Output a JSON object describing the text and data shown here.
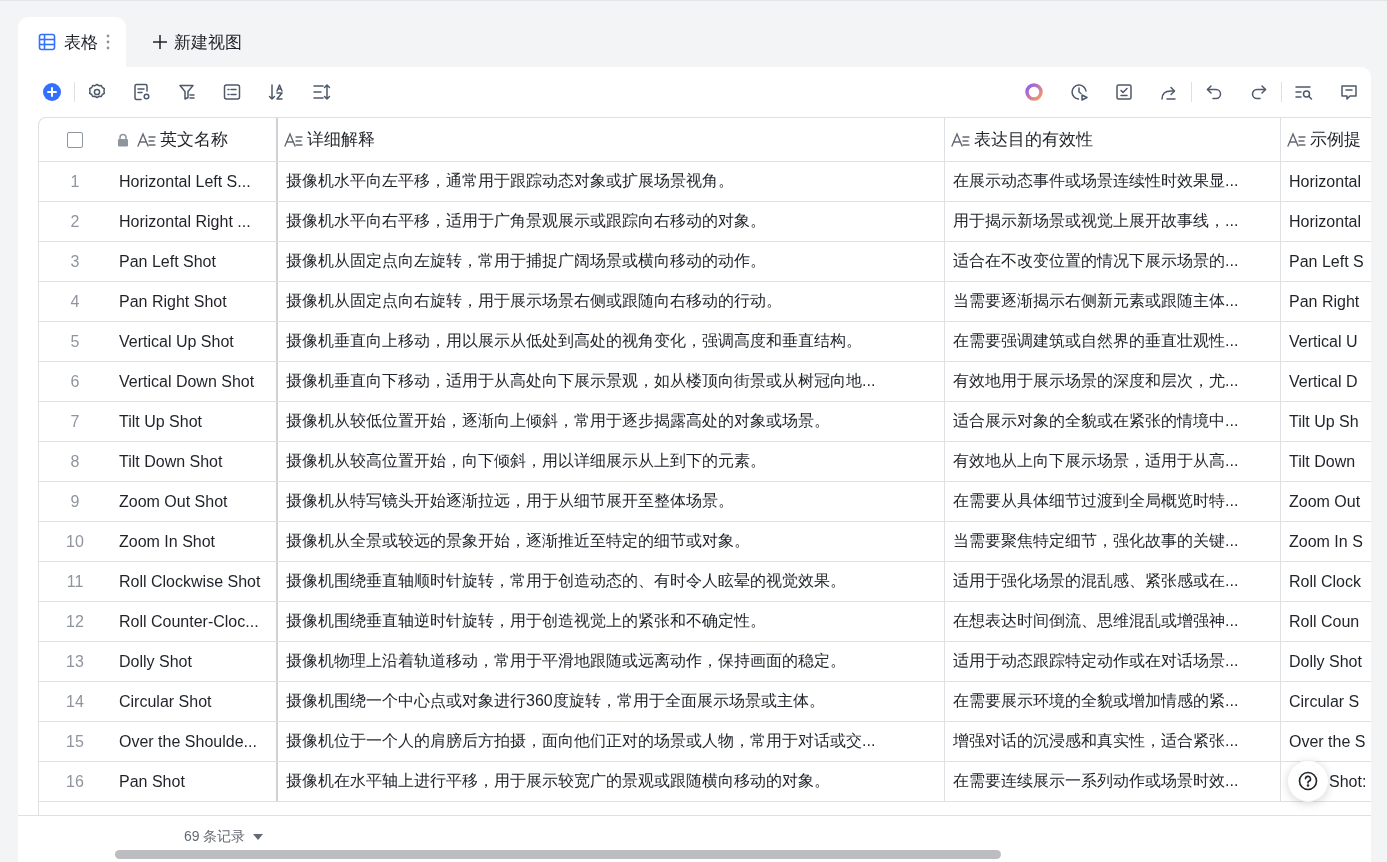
{
  "view_tabs": [
    {
      "label": "表格",
      "selected": true
    }
  ],
  "new_view_button": "新建视图",
  "table": {
    "header_checkbox": {
      "checked": false
    },
    "columns": [
      {
        "label": "英文名称",
        "locked": true
      },
      {
        "label": "详细解释",
        "locked": false
      },
      {
        "label": "表达目的有效性",
        "locked": false
      },
      {
        "label": "示例提",
        "locked": false
      }
    ],
    "rows": [
      {
        "index": "1",
        "name": "Horizontal Left S...",
        "detail": "摄像机水平向左平移，通常用于跟踪动态对象或扩展场景视角。",
        "effect": "在展示动态事件或场景连续性时效果显...",
        "example": "Horizontal"
      },
      {
        "index": "2",
        "name": "Horizontal Right ...",
        "detail": "摄像机水平向右平移，适用于广角景观展示或跟踪向右移动的对象。",
        "effect": "用于揭示新场景或视觉上展开故事线，...",
        "example": "Horizontal"
      },
      {
        "index": "3",
        "name": "Pan Left Shot",
        "detail": "摄像机从固定点向左旋转，常用于捕捉广阔场景或横向移动的动作。",
        "effect": "适合在不改变位置的情况下展示场景的...",
        "example": "Pan Left S"
      },
      {
        "index": "4",
        "name": "Pan Right Shot",
        "detail": "摄像机从固定点向右旋转，用于展示场景右侧或跟随向右移动的行动。",
        "effect": "当需要逐渐揭示右侧新元素或跟随主体...",
        "example": "Pan Right"
      },
      {
        "index": "5",
        "name": "Vertical Up Shot",
        "detail": "摄像机垂直向上移动，用以展示从低处到高处的视角变化，强调高度和垂直结构。",
        "effect": "在需要强调建筑或自然界的垂直壮观性...",
        "example": "Vertical U"
      },
      {
        "index": "6",
        "name": "Vertical Down Shot",
        "detail": "摄像机垂直向下移动，适用于从高处向下展示景观，如从楼顶向街景或从树冠向地...",
        "effect": "有效地用于展示场景的深度和层次，尤...",
        "example": "Vertical D"
      },
      {
        "index": "7",
        "name": "Tilt Up Shot",
        "detail": "摄像机从较低位置开始，逐渐向上倾斜，常用于逐步揭露高处的对象或场景。",
        "effect": "适合展示对象的全貌或在紧张的情境中...",
        "example": "Tilt Up Sh"
      },
      {
        "index": "8",
        "name": "Tilt Down Shot",
        "detail": "摄像机从较高位置开始，向下倾斜，用以详细展示从上到下的元素。",
        "effect": "有效地从上向下展示场景，适用于从高...",
        "example": "Tilt Down"
      },
      {
        "index": "9",
        "name": "Zoom Out Shot",
        "detail": "摄像机从特写镜头开始逐渐拉远，用于从细节展开至整体场景。",
        "effect": "在需要从具体细节过渡到全局概览时特...",
        "example": "Zoom Out"
      },
      {
        "index": "10",
        "name": "Zoom In Shot",
        "detail": "摄像机从全景或较远的景象开始，逐渐推近至特定的细节或对象。",
        "effect": "当需要聚焦特定细节，强化故事的关键...",
        "example": "Zoom In S"
      },
      {
        "index": "11",
        "name": "Roll Clockwise Shot",
        "detail": "摄像机围绕垂直轴顺时针旋转，常用于创造动态的、有时令人眩晕的视觉效果。",
        "effect": "适用于强化场景的混乱感、紧张感或在...",
        "example": "Roll Clock"
      },
      {
        "index": "12",
        "name": "Roll Counter-Cloc...",
        "detail": "摄像机围绕垂直轴逆时针旋转，用于创造视觉上的紧张和不确定性。",
        "effect": "在想表达时间倒流、思维混乱或增强神...",
        "example": "Roll Coun"
      },
      {
        "index": "13",
        "name": "Dolly Shot",
        "detail": "摄像机物理上沿着轨道移动，常用于平滑地跟随或远离动作，保持画面的稳定。",
        "effect": "适用于动态跟踪特定动作或在对话场景...",
        "example": "Dolly Shot"
      },
      {
        "index": "14",
        "name": "Circular Shot",
        "detail": "摄像机围绕一个中心点或对象进行360度旋转，常用于全面展示场景或主体。",
        "effect": "在需要展示环境的全貌或增加情感的紧...",
        "example": "Circular S"
      },
      {
        "index": "15",
        "name": "Over the Shoulde...",
        "detail": "摄像机位于一个人的肩膀后方拍摄，面向他们正对的场景或人物，常用于对话或交...",
        "effect": "增强对话的沉浸感和真实性，适合紧张...",
        "example": "Over the S"
      },
      {
        "index": "16",
        "name": "Pan Shot",
        "detail": "摄像机在水平轴上进行平移，用于展示较宽广的景观或跟随横向移动的对象。",
        "effect": "在需要连续展示一系列动作或场景时效...",
        "example": "Shot:"
      }
    ]
  },
  "record_count": "69 条记录"
}
